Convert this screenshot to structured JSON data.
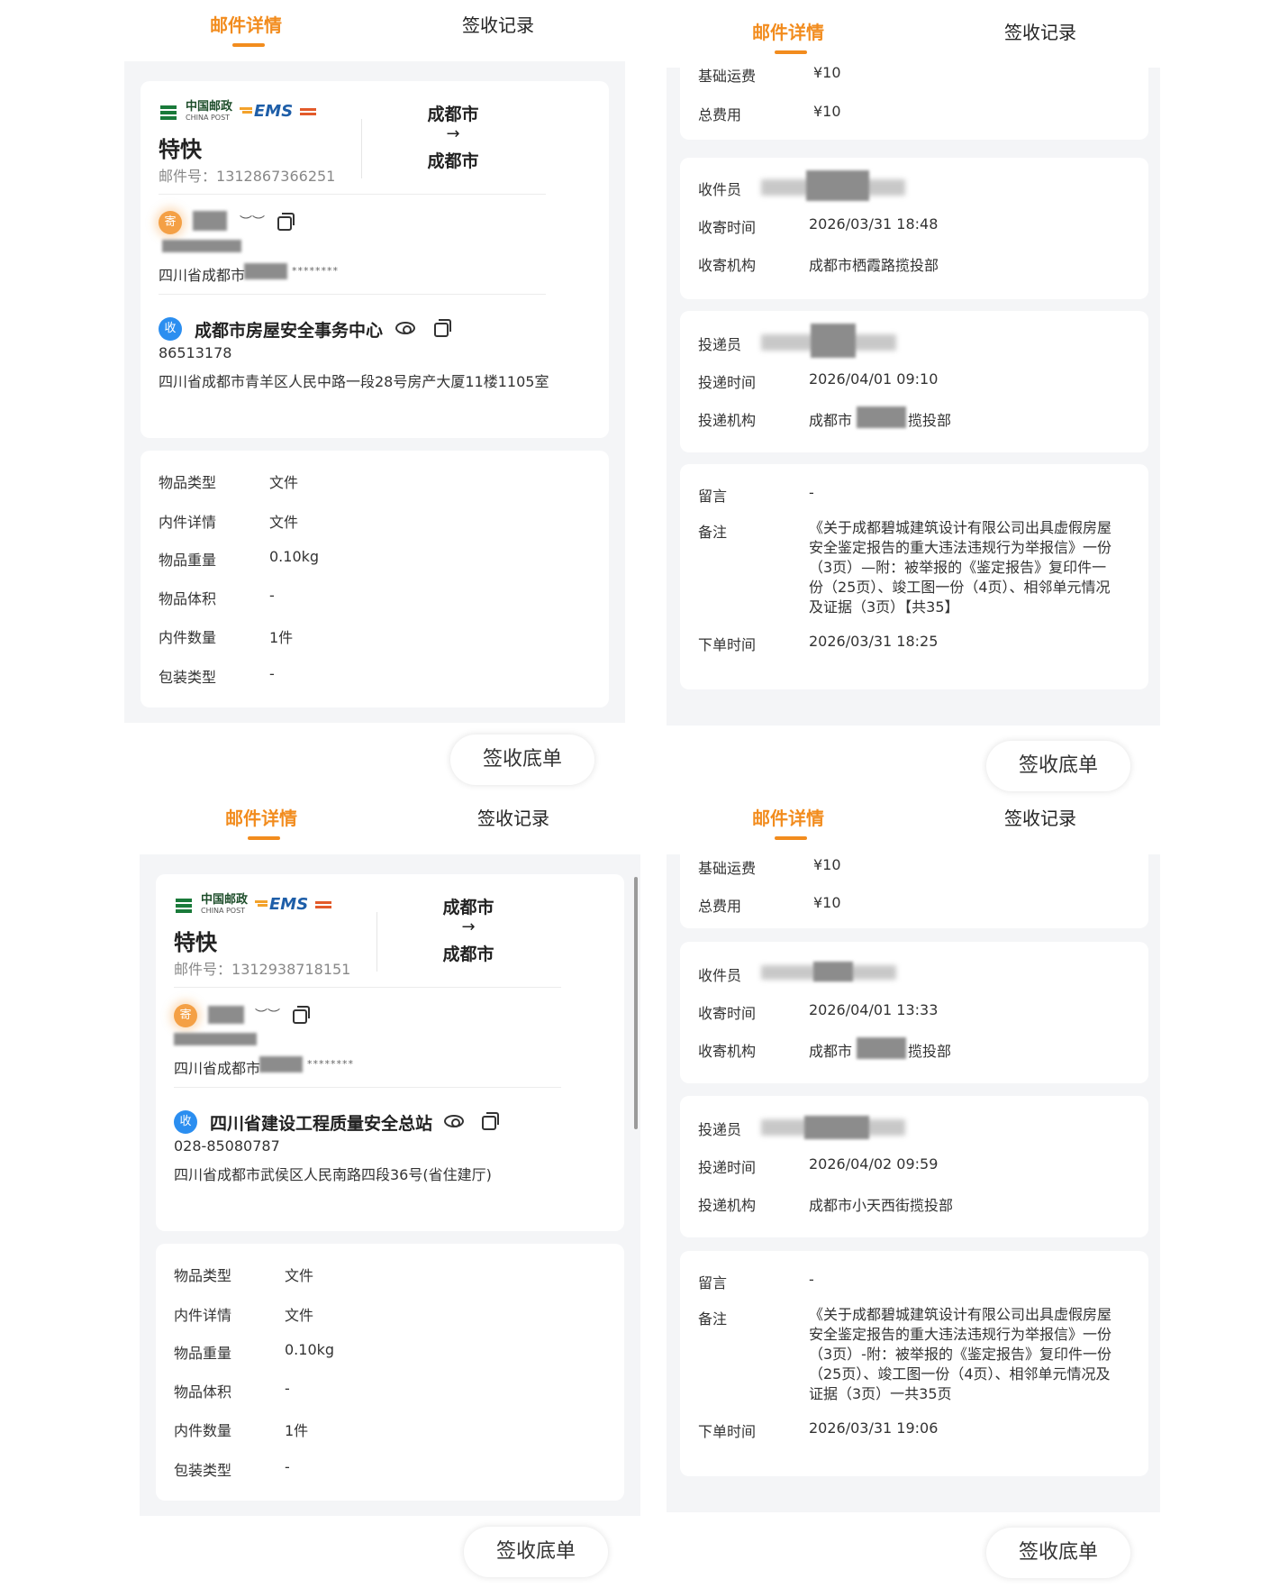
{
  "tabs": {
    "detail": "邮件详情",
    "records": "签收记录"
  },
  "sign_button": "签收底单",
  "logo": {
    "china_post_cn": "中国邮政",
    "china_post_en": "CHINA POST",
    "ems": "EMS"
  },
  "labels": {
    "item_type": "物品类型",
    "content_detail": "内件详情",
    "weight": "物品重量",
    "volume": "物品体积",
    "quantity": "内件数量",
    "package": "包装类型",
    "base_fee": "基础运费",
    "total_fee": "总费用",
    "collector": "收件员",
    "collect_time": "收寄时间",
    "collect_org": "收寄机构",
    "deliverer": "投递员",
    "deliver_time": "投递时间",
    "deliver_org": "投递机构",
    "message": "留言",
    "remark": "备注",
    "order_time": "下单时间",
    "tracking_prefix": "邮件号："
  },
  "sender_badge": "寄",
  "receiver_badge": "收",
  "masked_stars": "********",
  "mails": [
    {
      "service": "特快",
      "tracking_no": "1312867366251",
      "from_city": "成都市",
      "to_city": "成都市",
      "arrow": "→",
      "sender_address_prefix": "四川省成都市",
      "receiver_name": "成都市房屋安全事务中心",
      "receiver_phone": "86513178",
      "receiver_address": "四川省成都市青羊区人民中路一段28号房产大厦11楼1105室",
      "item_type": "文件",
      "content_detail": "文件",
      "weight": "0.10kg",
      "volume": "-",
      "quantity": "1件",
      "package": "-",
      "base_fee": "¥10",
      "total_fee": "¥10",
      "collect_time": "2026/03/31 18:48",
      "collect_org": "成都市栖霞路揽投部",
      "deliver_time": "2026/04/01 09:10",
      "deliver_org_prefix": "成都市",
      "deliver_org_suffix": "揽投部",
      "message": "-",
      "remark": "《关于成都碧城建筑设计有限公司出具虚假房屋安全鉴定报告的重大违法违规行为举报信》一份（3页）—附：被举报的《鉴定报告》复印件一份（25页）、竣工图一份（4页）、相邻单元情况及证据（3页）【共35】",
      "order_time": "2026/03/31 18:25"
    },
    {
      "service": "特快",
      "tracking_no": "1312938718151",
      "from_city": "成都市",
      "to_city": "成都市",
      "arrow": "→",
      "sender_address_prefix": "四川省成都市",
      "receiver_name": "四川省建设工程质量安全总站",
      "receiver_phone": "028-85080787",
      "receiver_address": "四川省成都市武侯区人民南路四段36号(省住建厅)",
      "item_type": "文件",
      "content_detail": "文件",
      "weight": "0.10kg",
      "volume": "-",
      "quantity": "1件",
      "package": "-",
      "base_fee": "¥10",
      "total_fee": "¥10",
      "collect_time": "2026/04/01 13:33",
      "collect_org_prefix": "成都市",
      "collect_org_suffix": "揽投部",
      "deliver_time": "2026/04/02 09:59",
      "deliver_org": "成都市小天西街揽投部",
      "message": "-",
      "remark": "《关于成都碧城建筑设计有限公司出具虚假房屋安全鉴定报告的重大违法违规行为举报信》一份（3页）-附：被举报的《鉴定报告》复印件一份（25页）、竣工图一份（4页）、相邻单元情况及证据（3页）一共35页",
      "order_time": "2026/03/31 19:06"
    }
  ]
}
